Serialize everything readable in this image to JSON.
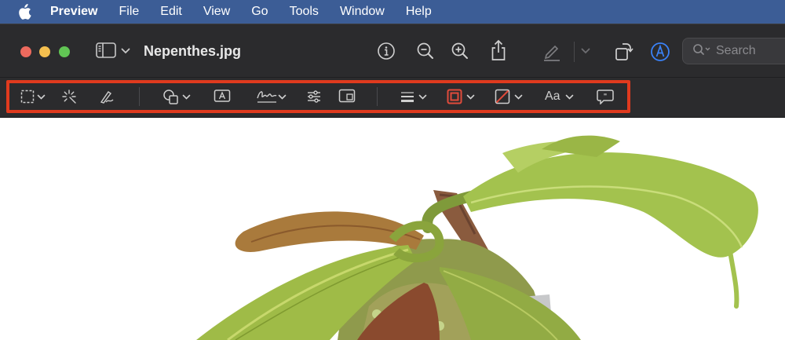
{
  "menubar": {
    "app_name": "Preview",
    "items": [
      "File",
      "Edit",
      "View",
      "Go",
      "Tools",
      "Window",
      "Help"
    ]
  },
  "window": {
    "title": "Nepenthes.jpg",
    "search_placeholder": "Search"
  },
  "markup_toolbar": {
    "tools": [
      "rectangular-selection",
      "instant-alpha",
      "sketch",
      "shapes",
      "text",
      "sign",
      "adjust-color",
      "adjust-size",
      "shape-style",
      "border-color",
      "fill-color",
      "text-style",
      "annotate"
    ],
    "text_style_label": "Aa",
    "highlight_color": "#e03a1e"
  },
  "colors": {
    "menubar": "#3c5d96",
    "toolbar": "#2b2b2d",
    "accent": "#3a82f7"
  }
}
